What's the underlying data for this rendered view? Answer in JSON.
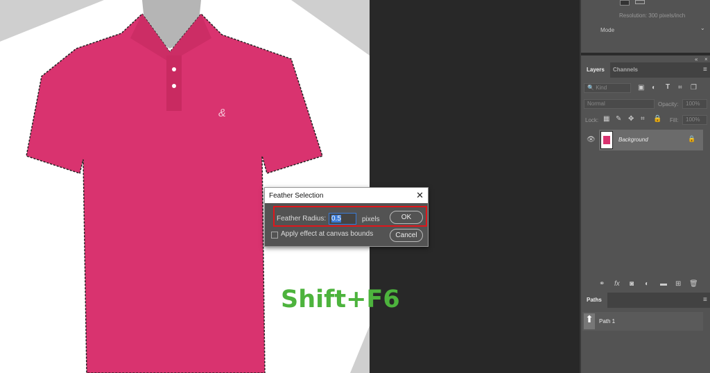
{
  "properties": {
    "resolution": "Resolution: 300 pixels/inch",
    "mode": "Mode"
  },
  "layers_panel": {
    "tabs": [
      {
        "label": "Layers",
        "active": true
      },
      {
        "label": "Channels",
        "active": false
      }
    ],
    "filter_placeholder": "Kind",
    "blend_mode": "Normal",
    "opacity_label": "Opacity:",
    "opacity": "100%",
    "lock_label": "Lock:",
    "fill_label": "Fill:",
    "fill": "100%",
    "layers": [
      {
        "name": "Background",
        "visible": true,
        "locked": true
      }
    ]
  },
  "paths_panel": {
    "tab": "Paths",
    "paths": [
      {
        "name": "Path 1"
      }
    ]
  },
  "dialog": {
    "title": "Feather Selection",
    "feather_radius_label": "Feather Radius:",
    "feather_radius_value": "0.5",
    "unit": "pixels",
    "ok_label": "OK",
    "cancel_label": "Cancel",
    "apply_canvas_bounds_label": "Apply effect at canvas bounds",
    "apply_canvas_bounds_checked": false
  },
  "overlay": {
    "shortcut": "Shift+F6",
    "shortcut_color": "#4db33d"
  },
  "colors": {
    "shirt": "#d9336f",
    "highlight": "#e0161b"
  }
}
